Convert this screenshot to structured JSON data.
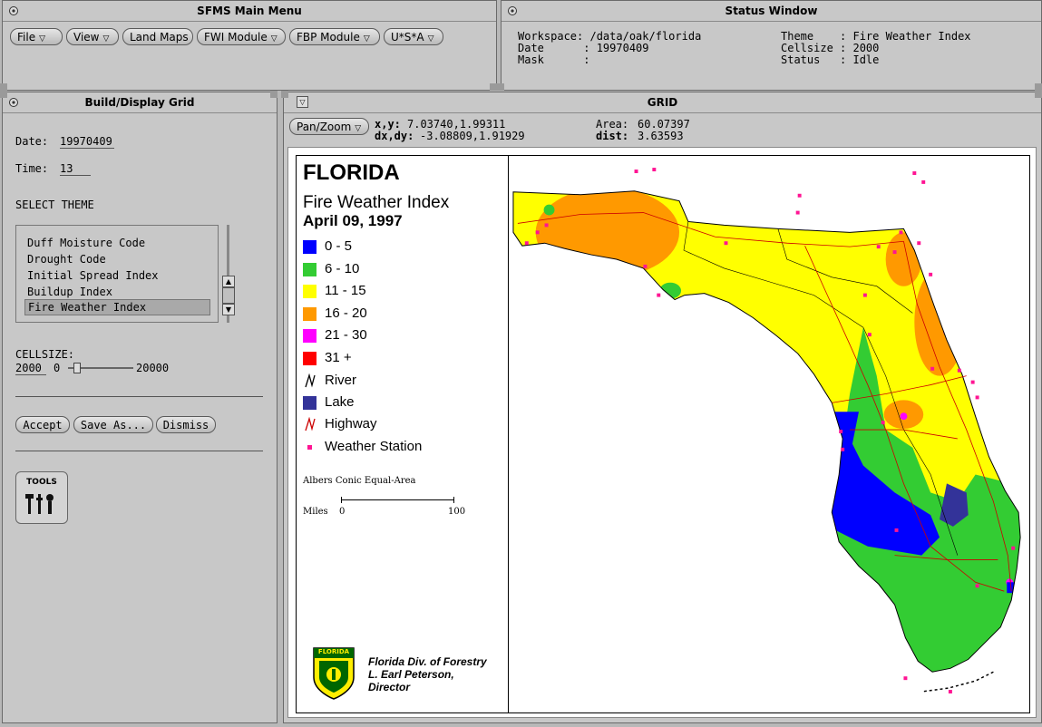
{
  "main_menu": {
    "title": "SFMS Main Menu",
    "items": [
      {
        "label": "File",
        "arrow": "▽"
      },
      {
        "label": "View",
        "arrow": "▽"
      },
      {
        "label": "Land Maps"
      },
      {
        "label": "FWI Module",
        "arrow": "▽"
      },
      {
        "label": "FBP Module",
        "arrow": "▽"
      },
      {
        "label": "U*S*A",
        "arrow": "▽"
      }
    ]
  },
  "status_window": {
    "title": "Status Window",
    "workspace_label": "Workspace: /data/oak/florida",
    "date_label": "Date      : 19970409",
    "mask_label": "Mask      :",
    "theme_label": "Theme    : Fire Weather Index",
    "cellsize_label": "Cellsize : 2000",
    "status_label": "Status   : Idle"
  },
  "build_grid": {
    "title": "Build/Display Grid",
    "date_label": "Date:",
    "date_value": "19970409",
    "time_label": "Time:",
    "time_value": "13",
    "select_theme_label": "SELECT THEME",
    "themes": [
      "Duff Moisture Code",
      "Drought Code",
      "Initial Spread Index",
      "Buildup Index",
      "Fire Weather Index"
    ],
    "selected_theme": "Fire Weather Index",
    "cellsize_label": "CELLSIZE:",
    "cellsize_value": "2000",
    "slider_min": "0",
    "slider_max": "20000",
    "slider_fraction": 0.1,
    "accept_label": "Accept",
    "save_as_label": "Save As...",
    "dismiss_label": "Dismiss",
    "tools_label": "TOOLS"
  },
  "grid_window": {
    "title": "GRID",
    "pan_zoom_label": "Pan/Zoom",
    "xy_label": "x,y:",
    "xy_value": "7.03740,1.99311",
    "dxdy_label": "dx,dy:",
    "dxdy_value": "-3.08809,1.91929",
    "area_label": "Area:",
    "area_value": "60.07397",
    "dist_label": "dist:",
    "dist_value": "3.63593"
  },
  "map_legend": {
    "state": "FLORIDA",
    "index_title": "Fire Weather Index",
    "date": "April 09, 1997",
    "classes": [
      {
        "label": "0 - 5",
        "color": "#0000ff"
      },
      {
        "label": "6 - 10",
        "color": "#33cc33"
      },
      {
        "label": "11 - 15",
        "color": "#ffff00"
      },
      {
        "label": "16 - 20",
        "color": "#ff9900"
      },
      {
        "label": "21 - 30",
        "color": "#ff00ff"
      },
      {
        "label": "31 +",
        "color": "#ff0000"
      }
    ],
    "river_label": "River",
    "lake_label": "Lake",
    "highway_label": "Highway",
    "station_label": "Weather Station",
    "projection": "Albers Conic Equal-Area",
    "scale_label": "Miles",
    "scale_min": "0",
    "scale_max": "100",
    "agency_line1": "Florida Div. of Forestry",
    "agency_line2": "L. Earl Peterson,",
    "agency_line3": "Director",
    "seal_text": "FLORIDA"
  },
  "colors": {
    "fwi_0_5": "#0000ff",
    "fwi_6_10": "#33cc33",
    "fwi_11_15": "#ffff00",
    "fwi_16_20": "#ff9900",
    "fwi_21_30": "#ff00ff",
    "lake": "#333399",
    "highway": "#cc0000",
    "station": "#ff1493"
  }
}
